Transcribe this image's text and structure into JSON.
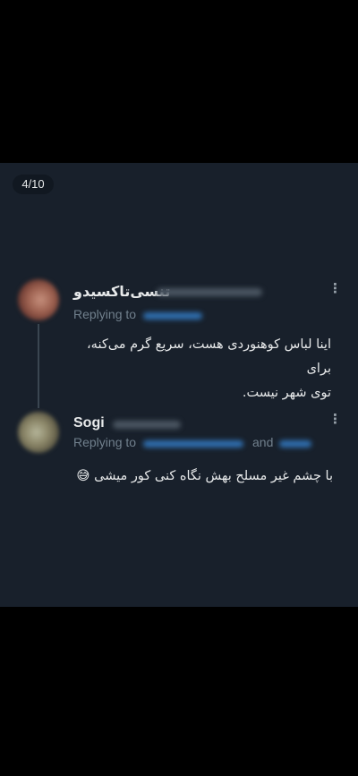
{
  "counter": "4/10",
  "tweets": [
    {
      "name": "تنسی‌تاکسیدو",
      "replying_prefix": "Replying to",
      "text_line1": "اینا لباس کوهنوردی هست، سریع گرم می‌کنه، برای",
      "text_line2": "توی شهر نیست."
    },
    {
      "name": "Sogi",
      "replying_prefix": "Replying to",
      "replying_and": "and",
      "text": "با چشم غیر مسلح بهش نگاه کنی کور میشی 😅"
    }
  ],
  "menu_glyph": "⋮",
  "colors": {
    "card_bg": "#18202b",
    "text": "#e7e9ea",
    "muted": "#71808d",
    "link": "#2f6fb0"
  }
}
